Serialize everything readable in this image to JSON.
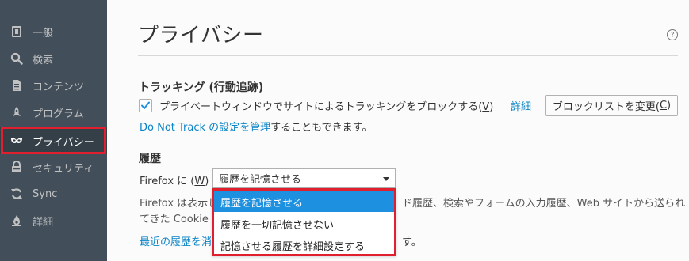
{
  "sidebar": {
    "items": [
      {
        "label": "一般",
        "icon": "general-icon"
      },
      {
        "label": "検索",
        "icon": "search-icon"
      },
      {
        "label": "コンテンツ",
        "icon": "content-icon"
      },
      {
        "label": "プログラム",
        "icon": "applications-icon"
      },
      {
        "label": "プライバシー",
        "icon": "privacy-mask-icon",
        "active": true
      },
      {
        "label": "セキュリティ",
        "icon": "security-icon"
      },
      {
        "label": "Sync",
        "icon": "sync-icon"
      },
      {
        "label": "詳細",
        "icon": "advanced-icon"
      }
    ]
  },
  "main": {
    "title": "プライバシー",
    "help_icon": "?",
    "tracking": {
      "heading": "トラッキング (行動追跡)",
      "checkbox_checked": true,
      "checkbox_label_pre": "プライベートウィンドウでサイトによるトラッキングをブロックする(",
      "checkbox_label_key": "V",
      "checkbox_label_post": ")",
      "details_link": "詳細",
      "blocklist_button_pre": "ブロックリストを変更(",
      "blocklist_button_key": "C",
      "blocklist_button_post": ")",
      "dnt_link": "Do Not Track の設定を管理",
      "dnt_suffix": "することもできます。"
    },
    "history": {
      "heading": "履歴",
      "prefix_pre": "Firefox に (",
      "prefix_key": "W",
      "prefix_post": ")",
      "select_value": "履歴を記憶させる",
      "desc_line1_start": "Firefox は表示し",
      "desc_line1_end": "ド履歴、検索やフォームの入力履歴、Web サイトから送られ",
      "desc_line2_start": "てきた Cookie を",
      "clear_link_start": "最近の履歴を消",
      "clear_suffix": "す。",
      "options": [
        {
          "label": "履歴を記憶させる",
          "selected": true
        },
        {
          "label": "履歴を一切記憶させない",
          "selected": false
        },
        {
          "label": "記憶させる履歴を詳細設定する",
          "selected": false
        }
      ]
    }
  },
  "colors": {
    "sidebar_bg": "#424f5a",
    "sidebar_active": "#343f48",
    "highlight_red": "#e0202f",
    "link_blue": "#0a84c6",
    "selected_option": "#1e90e0"
  }
}
